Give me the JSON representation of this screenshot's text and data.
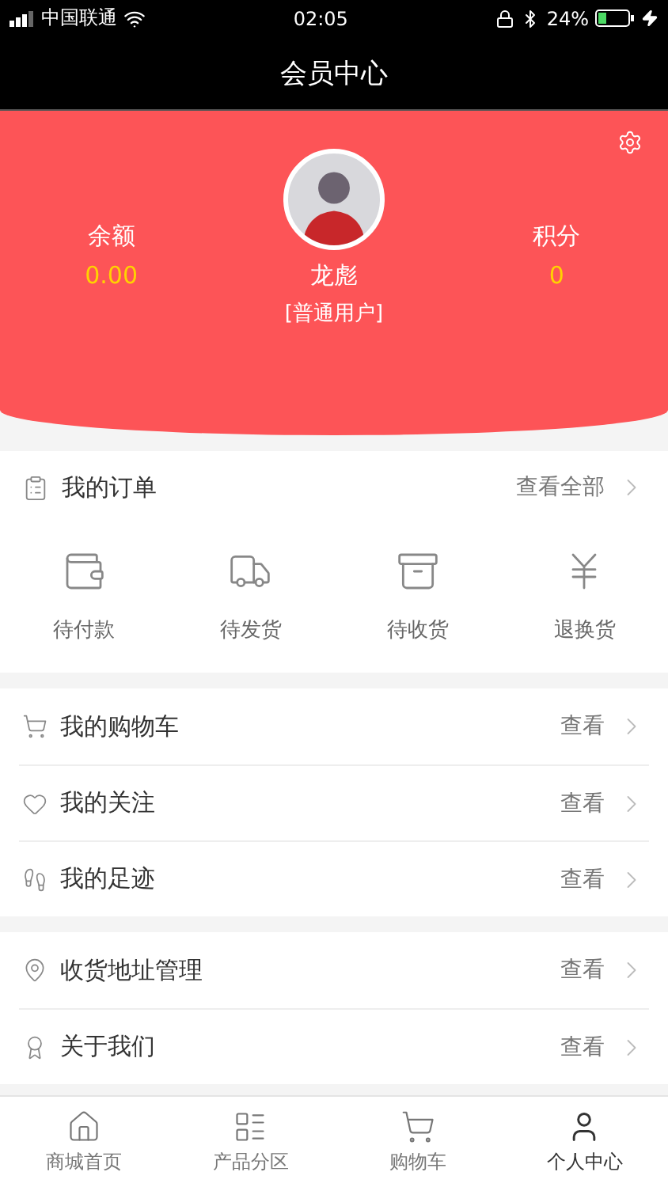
{
  "status_bar": {
    "carrier": "中国联通",
    "time": "02:05",
    "battery": "24%"
  },
  "nav_bar": {
    "title": "会员中心"
  },
  "profile": {
    "balance": {
      "label": "余额",
      "value": "0.00"
    },
    "name": "龙彪",
    "level": "[普通用户]",
    "points": {
      "label": "积分",
      "value": "0"
    }
  },
  "orders": {
    "title": "我的订单",
    "link": "查看全部",
    "items": [
      {
        "kind": "wallet",
        "label": "待付款"
      },
      {
        "kind": "truck",
        "label": "待发货"
      },
      {
        "kind": "box",
        "label": "待收货"
      },
      {
        "kind": "refund",
        "label": "退换货"
      }
    ]
  },
  "menu_groups": [
    {
      "items": [
        {
          "kind": "cart",
          "label": "我的购物车",
          "link": "查看"
        },
        {
          "kind": "heart",
          "label": "我的关注",
          "link": "查看"
        },
        {
          "kind": "footprint",
          "label": "我的足迹",
          "link": "查看"
        }
      ]
    },
    {
      "items": [
        {
          "kind": "pin",
          "label": "收货地址管理",
          "link": "查看"
        },
        {
          "kind": "award",
          "label": "关于我们",
          "link": "查看"
        }
      ]
    }
  ],
  "tab_bar": [
    {
      "kind": "home",
      "label": "商城首页",
      "selected": false
    },
    {
      "kind": "grid",
      "label": "产品分区",
      "selected": false
    },
    {
      "kind": "cart",
      "label": "购物车",
      "selected": false
    },
    {
      "kind": "user",
      "label": "个人中心",
      "selected": true
    }
  ]
}
